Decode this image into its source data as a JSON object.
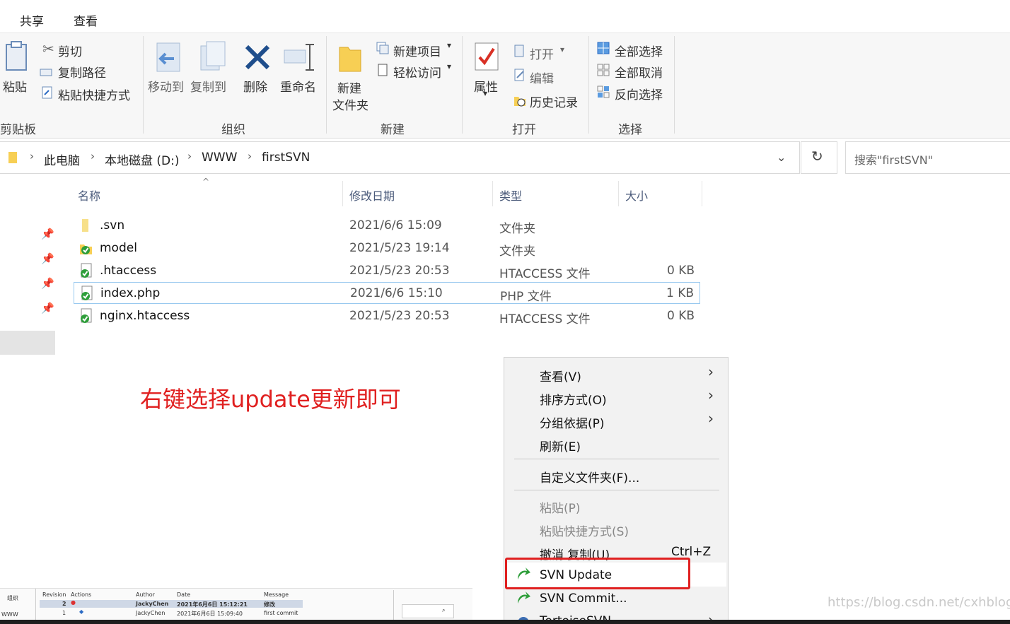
{
  "ribbon_tabs": [
    "共享",
    "查看"
  ],
  "clipboard": {
    "paste": "粘贴",
    "cut": "剪切",
    "copy_path": "复制路径",
    "paste_shortcut": "粘贴快捷方式",
    "label": "剪贴板"
  },
  "organize": {
    "move_to": "移动到",
    "copy_to": "复制到",
    "delete": "删除",
    "rename": "重命名",
    "label": "组织"
  },
  "new_group": {
    "new_folder_line1": "新建",
    "new_folder_line2": "文件夹",
    "new_item": "新建项目",
    "easy_access": "轻松访问",
    "label": "新建"
  },
  "open_group": {
    "properties": "属性",
    "open": "打开",
    "edit": "编辑",
    "history": "历史记录",
    "label": "打开"
  },
  "select_group": {
    "select_all": "全部选择",
    "select_none": "全部取消",
    "invert": "反向选择",
    "label": "选择"
  },
  "address": {
    "crumbs": [
      "此电脑",
      "本地磁盘 (D:)",
      "WWW",
      "firstSVN"
    ],
    "search_placeholder": "搜索\"firstSVN\""
  },
  "columns": {
    "name": "名称",
    "date": "修改日期",
    "type": "类型",
    "size": "大小"
  },
  "files": [
    {
      "name": ".svn",
      "date": "2021/6/6 15:09",
      "type": "文件夹",
      "size": "",
      "icon": "folder-icon"
    },
    {
      "name": "model",
      "date": "2021/5/23 19:14",
      "type": "文件夹",
      "size": "",
      "icon": "svn-folder-icon"
    },
    {
      "name": ".htaccess",
      "date": "2021/5/23 20:53",
      "type": "HTACCESS 文件",
      "size": "0 KB",
      "icon": "svn-file-icon"
    },
    {
      "name": "index.php",
      "date": "2021/6/6 15:10",
      "type": "PHP 文件",
      "size": "1 KB",
      "icon": "svn-file-icon"
    },
    {
      "name": "nginx.htaccess",
      "date": "2021/5/23 20:53",
      "type": "HTACCESS 文件",
      "size": "0 KB",
      "icon": "svn-file-icon"
    }
  ],
  "annotation": "右键选择update更新即可",
  "context_menu": {
    "view": "查看(V)",
    "sort": "排序方式(O)",
    "group": "分组依据(P)",
    "refresh": "刷新(E)",
    "customize": "自定义文件夹(F)...",
    "paste": "粘贴(P)",
    "paste_shortcut": "粘贴快捷方式(S)",
    "undo": "撤消 复制(U)",
    "undo_shortcut": "Ctrl+Z",
    "svn_update": "SVN Update",
    "svn_commit": "SVN Commit...",
    "tortoise": "TortoiseSVN"
  },
  "thumbnail": {
    "headers": [
      "Revision",
      "Actions",
      "Author",
      "Date",
      "Message"
    ],
    "rows": [
      {
        "rev": "2",
        "author": "JackyChen",
        "date": "2021年6月6日 15:12:21",
        "msg": "修改"
      },
      {
        "rev": "1",
        "author": "JackyChen",
        "date": "2021年6月6日 15:09:40",
        "msg": "first commit"
      }
    ],
    "side": [
      "组织",
      "WWW"
    ]
  },
  "watermark": "https://blog.csdn.net/cxhblog",
  "colors": {
    "accent_red": "#e02020",
    "svn_green": "#2e9e3a",
    "selection": "#99c9ef"
  }
}
